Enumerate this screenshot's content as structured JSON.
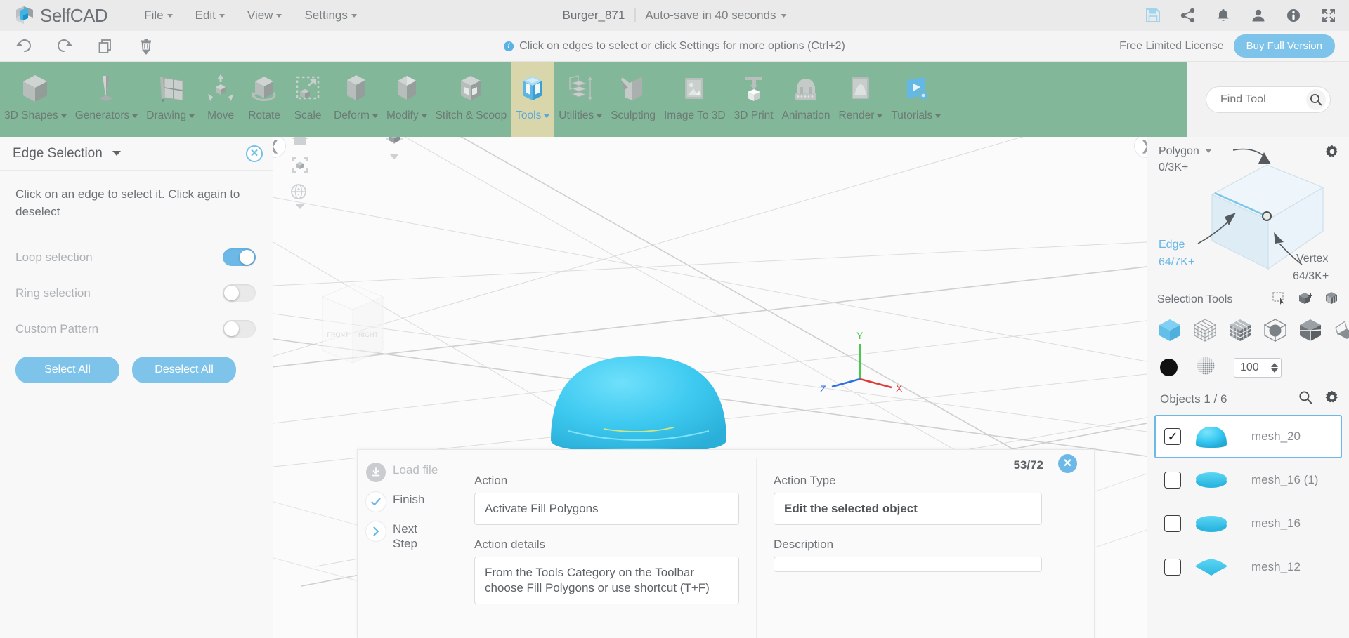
{
  "app": {
    "brand": "SelfCAD",
    "menus": [
      {
        "label": "File",
        "has_caret": true
      },
      {
        "label": "Edit",
        "has_caret": true
      },
      {
        "label": "View",
        "has_caret": true
      },
      {
        "label": "Settings",
        "has_caret": true
      }
    ],
    "document_name": "Burger_871",
    "autosave": "Auto-save in 40 seconds",
    "top_icons": [
      {
        "name": "save-icon",
        "glyph": "save"
      },
      {
        "name": "share-icon",
        "glyph": "share"
      },
      {
        "name": "notifications-bell-icon",
        "glyph": "bell"
      },
      {
        "name": "user-account-icon",
        "glyph": "user"
      },
      {
        "name": "info-icon",
        "glyph": "info"
      },
      {
        "name": "fullscreen-icon",
        "glyph": "expand"
      }
    ]
  },
  "secondbar": {
    "history": [
      {
        "name": "undo-button",
        "glyph": "undo"
      },
      {
        "name": "redo-button",
        "glyph": "redo"
      },
      {
        "name": "copy-button",
        "glyph": "copy"
      },
      {
        "name": "delete-button",
        "glyph": "trash"
      }
    ],
    "hint": "Click on edges to select or click Settings for more options (Ctrl+2)",
    "license": "Free Limited License",
    "buy_button": "Buy Full Version"
  },
  "toolbar": {
    "active_tool": "Tools",
    "search_placeholder": "Find Tool",
    "search_value": "",
    "items": [
      {
        "label": "3D Shapes",
        "caret": true,
        "icon": "cube-icon"
      },
      {
        "label": "Generators",
        "caret": true,
        "icon": "cone-generator-icon"
      },
      {
        "label": "Drawing",
        "caret": true,
        "icon": "pencil-grid-icon"
      },
      {
        "label": "Move",
        "caret": false,
        "icon": "move-arrows-icon"
      },
      {
        "label": "Rotate",
        "caret": false,
        "icon": "rotate-cube-icon"
      },
      {
        "label": "Scale",
        "caret": false,
        "icon": "scale-cube-icon"
      },
      {
        "label": "Deform",
        "caret": true,
        "icon": "deform-cube-icon"
      },
      {
        "label": "Modify",
        "caret": true,
        "icon": "modify-cube-icon"
      },
      {
        "label": "Stitch & Scoop",
        "caret": false,
        "icon": "stitch-scoop-icon"
      },
      {
        "label": "Tools",
        "caret": true,
        "icon": "tools-cube-icon"
      },
      {
        "label": "Utilities",
        "caret": true,
        "icon": "utilities-layers-icon"
      },
      {
        "label": "Sculpting",
        "caret": false,
        "icon": "sculpting-icon"
      },
      {
        "label": "Image To 3D",
        "caret": false,
        "icon": "image-to-3d-icon"
      },
      {
        "label": "3D Print",
        "caret": false,
        "icon": "3d-print-icon"
      },
      {
        "label": "Animation",
        "caret": false,
        "icon": "animation-filmstrip-icon"
      },
      {
        "label": "Render",
        "caret": true,
        "icon": "render-icon"
      },
      {
        "label": "Tutorials",
        "caret": true,
        "icon": "tutorials-play-icon"
      }
    ]
  },
  "left_panel": {
    "title": "Edge Selection",
    "description": "Click on an edge to select it. Click again to deselect",
    "options": [
      {
        "label": "Loop selection",
        "on": true
      },
      {
        "label": "Ring selection",
        "on": false
      },
      {
        "label": "Custom Pattern",
        "on": false
      }
    ],
    "select_all": "Select All",
    "deselect_all": "Deselect All"
  },
  "viewport": {
    "cube_faces": {
      "front": "FRONT",
      "right": "RIGHT"
    },
    "axis": {
      "x": "X",
      "y": "Y",
      "z": "Z"
    },
    "icons": [
      {
        "name": "home-view-icon"
      },
      {
        "name": "fit-to-view-icon"
      },
      {
        "name": "orbit-icon"
      },
      {
        "name": "view-cube-options-icon"
      }
    ]
  },
  "tutorial": {
    "steps": [
      {
        "label": "Load file",
        "state": "done-grey",
        "icon": "download-icon"
      },
      {
        "label": "Finish",
        "state": "check",
        "icon": "check-icon"
      },
      {
        "label": "Next Step",
        "state": "next",
        "icon": "chevron-right-icon"
      }
    ],
    "action_label": "Action",
    "action_value": "Activate Fill Polygons",
    "action_details_label": "Action details",
    "action_details_value": "From the Tools Category on the Toolbar choose Fill Polygons or use shortcut (T+F)",
    "action_type_label": "Action Type",
    "action_type_value": "Edit the selected object",
    "description_label": "Description",
    "description_value": "",
    "counter": "53/72"
  },
  "right_panel": {
    "selection_mode": "Polygon",
    "polygon_count": "0/3K+",
    "edge_label": "Edge",
    "edge_count": "64/7K+",
    "vertex_label": "Vertex",
    "vertex_count": "64/3K+",
    "selection_tools_label": "Selection Tools",
    "selection_tool_icons": [
      {
        "name": "rect-select-icon"
      },
      {
        "name": "add-object-select-icon"
      },
      {
        "name": "through-select-icon"
      }
    ],
    "shape_tools": [
      {
        "name": "cube-select-icon",
        "active": true
      },
      {
        "name": "wireframe-grid-icon",
        "active": false
      },
      {
        "name": "dense-grid-cube-icon",
        "active": false
      },
      {
        "name": "sphere-in-cube-icon",
        "active": false
      },
      {
        "name": "split-cube-icon",
        "active": false
      },
      {
        "name": "plane-fold-icon",
        "active": false
      }
    ],
    "color_swatch": "#111111",
    "opacity_value": "100",
    "objects_label": "Objects 1 / 6",
    "objects": [
      {
        "name": "mesh_20",
        "checked": true,
        "selected": true,
        "shape": "dome"
      },
      {
        "name": "mesh_16 (1)",
        "checked": false,
        "selected": false,
        "shape": "disc"
      },
      {
        "name": "mesh_16",
        "checked": false,
        "selected": false,
        "shape": "disc"
      },
      {
        "name": "mesh_12",
        "checked": false,
        "selected": false,
        "shape": "diamond"
      }
    ]
  },
  "colors": {
    "toolbar_green": "#82b79a",
    "active_tool_bg": "#d9d6ac",
    "accent_blue": "#6cb9e8",
    "mesh_cyan": "#3bc6ef"
  }
}
